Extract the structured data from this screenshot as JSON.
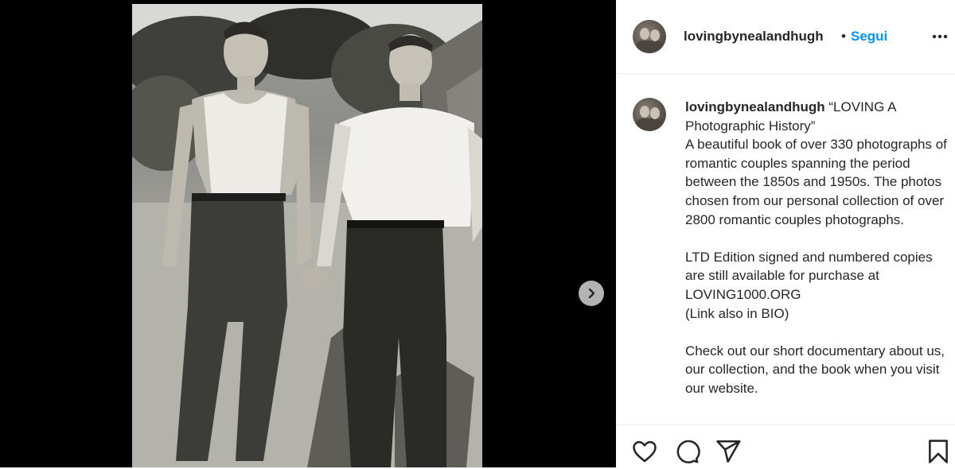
{
  "post": {
    "username": "lovingbynealandhugh",
    "separator": "•",
    "follow_label": "Segui",
    "more_icon": "more-horizontal-icon",
    "caption_title": " “LOVING A Photographic History”",
    "caption_body": "A beautiful book of over 330 photographs of romantic couples spanning the period between the 1850s and 1950s. The photos chosen from our personal collection of over 2800 romantic couples photographs.\n\nLTD Edition signed and numbered copies are still available for purchase at LOVING1000.ORG\n(Link also in BIO)\n\nCheck out our short documentary about us, our collection, and the book when you visit our website."
  },
  "media": {
    "description_icon": "photo",
    "next_icon": "chevron-right-icon"
  },
  "actions": {
    "icons": [
      "heart-icon",
      "comment-icon",
      "share-icon",
      "bookmark-icon"
    ]
  },
  "colors": {
    "link": "#0095f6",
    "text": "#262626",
    "divider": "#efefef",
    "media_bg": "#000000"
  }
}
